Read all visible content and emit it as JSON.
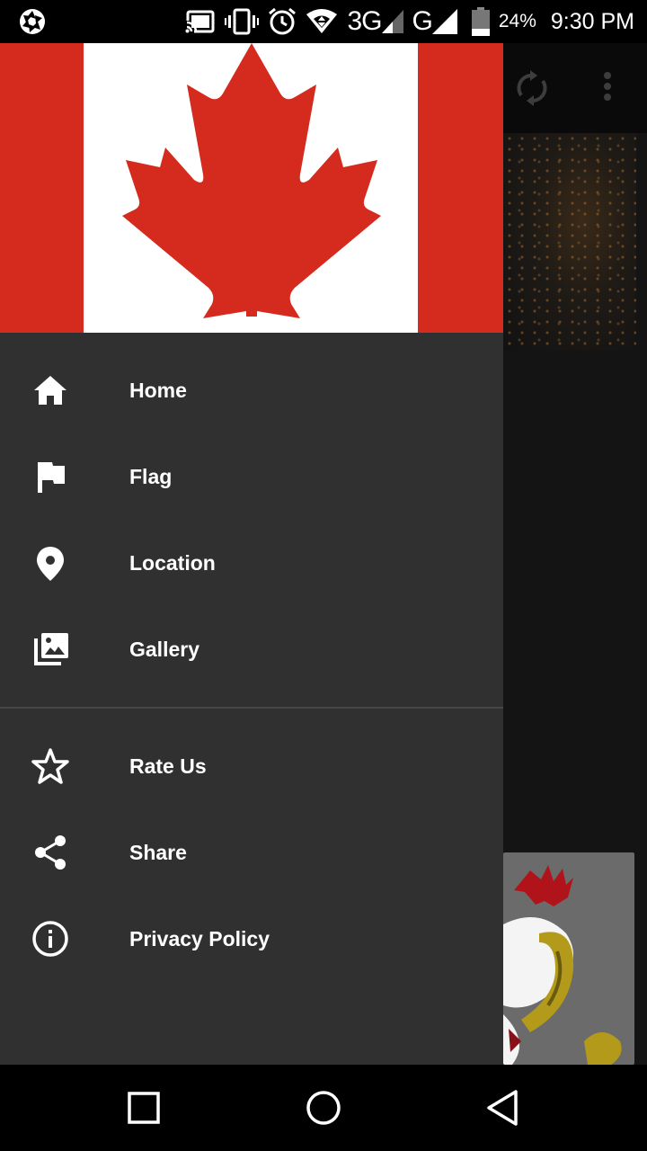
{
  "status_bar": {
    "network_label": "3G",
    "network2_label": "G",
    "battery_percent": "24%",
    "battery_level": 0.24,
    "time": "9:30 PM",
    "icons": [
      "aperture-icon",
      "cast-icon",
      "vibrate-icon",
      "alarm-icon",
      "wifi-icon",
      "signal-icon",
      "battery-icon"
    ]
  },
  "drawer": {
    "header_image": "canada-flag",
    "menu_primary": [
      {
        "label": "Home",
        "icon": "home-icon"
      },
      {
        "label": "Flag",
        "icon": "flag-icon"
      },
      {
        "label": "Location",
        "icon": "location-pin-icon"
      },
      {
        "label": "Gallery",
        "icon": "gallery-icon"
      }
    ],
    "menu_secondary": [
      {
        "label": "Rate Us",
        "icon": "star-icon"
      },
      {
        "label": "Share",
        "icon": "share-icon"
      },
      {
        "label": "Privacy Policy",
        "icon": "info-icon"
      }
    ]
  },
  "background_app": {
    "toolbar_actions": [
      "refresh-icon",
      "more-vert-icon"
    ]
  },
  "nav_bar": {
    "buttons": [
      "recents-button",
      "home-button",
      "back-button"
    ]
  },
  "colors": {
    "drawer_bg": "#303030",
    "flag_red": "#d52b1e",
    "text": "#ffffff"
  }
}
